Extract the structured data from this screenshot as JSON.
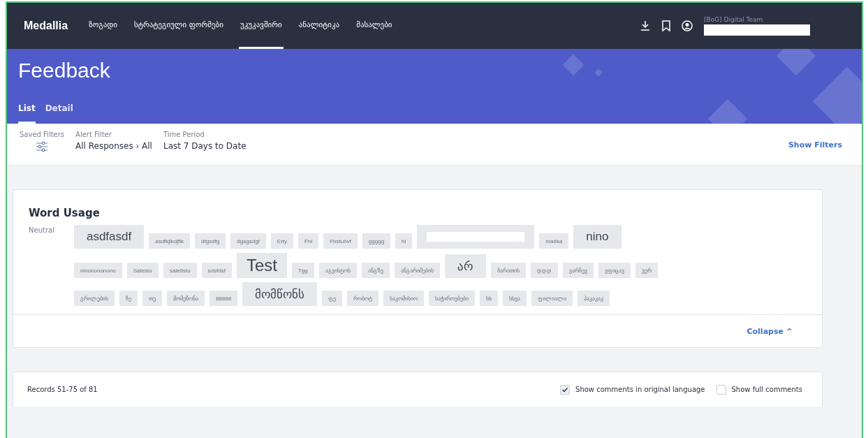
{
  "topbar": {
    "logo": "Medallia",
    "nav": [
      {
        "label": "ზოგადი",
        "selected": false
      },
      {
        "label": "სტრატეგიული ფორმები",
        "selected": false
      },
      {
        "label": "უკუკავშირი",
        "selected": true
      },
      {
        "label": "ანალიტიკა",
        "selected": false
      },
      {
        "label": "მასალები",
        "selected": false
      }
    ],
    "user": {
      "team": "[BoG] Digital Team",
      "name_redacted": true
    }
  },
  "header": {
    "title": "Feedback",
    "tabs": [
      {
        "label": "List",
        "selected": true
      },
      {
        "label": "Detail",
        "selected": false
      }
    ]
  },
  "filters": {
    "saved_label": "Saved Filters",
    "items": [
      {
        "label": "Alert Filter",
        "value": "All Responses › All"
      },
      {
        "label": "Time Period",
        "value": "Last 7 Days to Date"
      }
    ],
    "show": "Show Filters"
  },
  "word_usage": {
    "title": "Word Usage",
    "sentiment": "Neutral",
    "words": [
      {
        "text": "asdfasdf",
        "kind": "large"
      },
      {
        "text": "asdfkjlkdjflk",
        "kind": "small"
      },
      {
        "text": "dfgsdfg",
        "kind": "small"
      },
      {
        "text": "dgsgsdgf",
        "kind": "small"
      },
      {
        "text": "Erty",
        "kind": "small"
      },
      {
        "text": "Fhl",
        "kind": "small"
      },
      {
        "text": "Fhstuhvf",
        "kind": "small"
      },
      {
        "text": "ggggg",
        "kind": "small"
      },
      {
        "text": "hi",
        "kind": "small"
      },
      {
        "kind": "redacted"
      },
      {
        "text": "marika",
        "kind": "small"
      },
      {
        "text": "nino",
        "kind": "large"
      },
      {
        "text": "ninonononono",
        "kind": "small",
        "new_line": true
      },
      {
        "text": "Satesto",
        "kind": "small"
      },
      {
        "text": "satetisto",
        "kind": "small"
      },
      {
        "text": "sdsfdsf",
        "kind": "small"
      },
      {
        "text": "Test",
        "kind": "xlarge"
      },
      {
        "text": "Tgg",
        "kind": "small"
      },
      {
        "text": "აგვისტოს",
        "kind": "small"
      },
      {
        "text": "ანგ'ზე",
        "kind": "small"
      },
      {
        "text": "ანგარიშების",
        "kind": "small"
      },
      {
        "text": "არ",
        "kind": "large"
      },
      {
        "text": "ბარათის",
        "kind": "small"
      },
      {
        "text": "დდდ",
        "kind": "small"
      },
      {
        "text": "ვარჩევ",
        "kind": "small"
      },
      {
        "text": "ვფიცავ",
        "kind": "small"
      },
      {
        "text": "ვერ",
        "kind": "small"
      },
      {
        "text": "გრილების",
        "kind": "small",
        "new_line": true
      },
      {
        "text": "ზე",
        "kind": "small"
      },
      {
        "text": "თუ",
        "kind": "small"
      },
      {
        "text": "მომეწონა",
        "kind": "small"
      },
      {
        "text": "88888",
        "kind": "small"
      },
      {
        "text": "მომწონს",
        "kind": "large"
      },
      {
        "text": "ფე",
        "kind": "small"
      },
      {
        "text": "რობოტ",
        "kind": "small"
      },
      {
        "text": "საკომისიო",
        "kind": "small"
      },
      {
        "text": "საჭიროებები",
        "kind": "small"
      },
      {
        "text": "სხ",
        "kind": "small"
      },
      {
        "text": "სხვა",
        "kind": "small"
      },
      {
        "text": "ფილიალი",
        "kind": "small"
      },
      {
        "text": "ჰაკაკაკ",
        "kind": "small"
      }
    ],
    "collapse": "Collapse ^"
  },
  "records": {
    "count": "Records 51-75 of 81",
    "options": [
      {
        "label": "Show comments in original language",
        "checked": true
      },
      {
        "label": "Show full comments",
        "checked": false
      }
    ]
  }
}
